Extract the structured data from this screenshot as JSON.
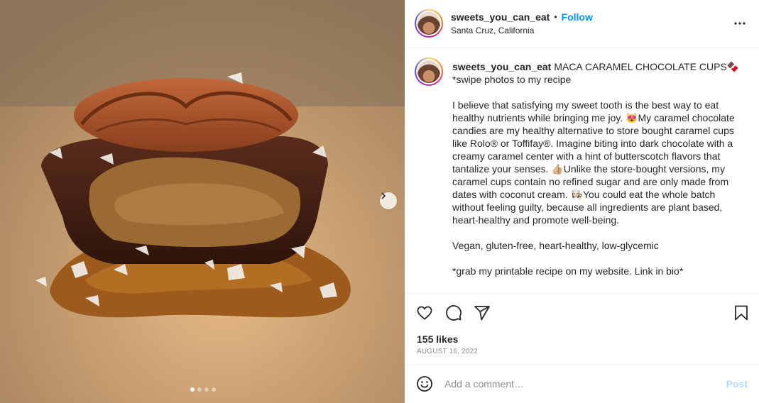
{
  "post": {
    "username": "sweets_you_can_eat",
    "follow_label": "Follow",
    "separator": "•",
    "location": "Santa Cruz, California",
    "caption_username": "sweets_you_can_eat",
    "caption_text": "MACA CARAMEL CHOCOLATE CUPS🍫\n*swipe photos to my recipe\n\nI believe that satisfying my sweet tooth is the best way to eat healthy nutrients while bringing me joy. 😻My caramel chocolate candies are my healthy alternative to store bought caramel cups like Rolo® or Toffifay®. Imagine biting into dark chocolate with a creamy caramel center with a hint of butterscotch flavors that tantalize your senses. 👍🏼Unlike the store-bought versions, my caramel cups contain no refined sugar and are only made from dates with coconut cream. 👩🏻‍🍳You could eat the whole batch without feeling guilty, because all ingredients are plant based, heart-healthy and promote well-being.\n\nVegan, gluten-free, heart-healthy, low-glycemic\n\n*grab my printable recipe on my website. Link in bio*",
    "likes": "155 likes",
    "date": "AUGUST 16, 2022",
    "carousel": {
      "total": 4,
      "current": 1
    }
  },
  "comment": {
    "placeholder": "Add a comment…",
    "post_label": "Post"
  },
  "icons": {
    "more": "more-options-icon",
    "like": "heart-icon",
    "comment": "comment-icon",
    "share": "share-icon",
    "save": "bookmark-icon",
    "emoji": "emoji-icon",
    "next": "chevron-right-icon"
  },
  "colors": {
    "link": "#0095f6",
    "post_disabled": "#b3dbff",
    "muted": "#8e8e8e",
    "text": "#262626"
  }
}
